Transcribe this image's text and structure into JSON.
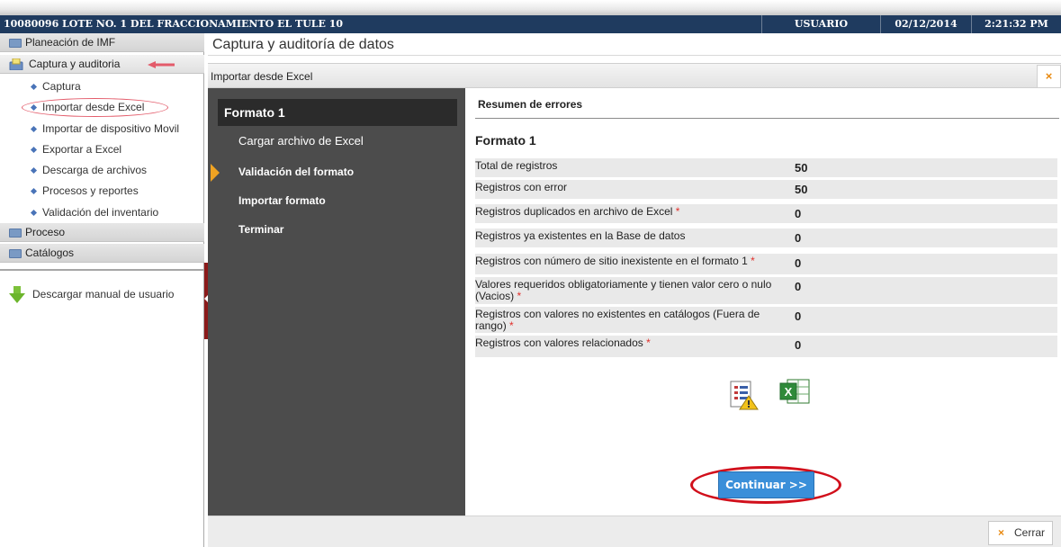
{
  "titlebar": {
    "title": "10080096 LOTE NO. 1 DEL FRACCIONAMIENTO EL TULE 10",
    "user": "USUARIO",
    "date": "02/12/2014",
    "time": "2:21:32 PM"
  },
  "sidebar": {
    "sections": [
      {
        "label": "Planeación de IMF",
        "icon": "folder-icon"
      },
      {
        "label": "Captura y auditoria",
        "icon": "capture-icon",
        "active": true
      },
      {
        "label": "Proceso",
        "icon": "folder-icon"
      },
      {
        "label": "Catálogos",
        "icon": "folder-icon"
      }
    ],
    "items": [
      {
        "label": "Captura"
      },
      {
        "label": "Importar desde Excel",
        "highlighted": true
      },
      {
        "label": "Importar de dispositivo Movil"
      },
      {
        "label": "Exportar a Excel"
      },
      {
        "label": "Descarga de archivos"
      },
      {
        "label": "Procesos y reportes"
      },
      {
        "label": "Validación del inventario"
      }
    ],
    "download_manual": "Descargar manual de usuario"
  },
  "main": {
    "title": "Captura y auditoría de datos",
    "panel_title": "Importar desde Excel",
    "panel_close": "×"
  },
  "wizard": {
    "heading": "Formato 1",
    "steps": [
      {
        "label": "Cargar archivo de Excel"
      },
      {
        "label": "Validación del formato",
        "active": true
      },
      {
        "label": "Importar formato"
      },
      {
        "label": "Terminar"
      }
    ]
  },
  "summary": {
    "title": "Resumen de errores",
    "format_title": "Formato 1",
    "rows": [
      {
        "label": "Total de registros",
        "value": "50",
        "required": false
      },
      {
        "label": "Registros con error",
        "value": "50",
        "required": false
      },
      {
        "label": "Registros duplicados en archivo de Excel",
        "value": "0",
        "required": true
      },
      {
        "label": "Registros ya existentes en la Base de datos",
        "value": "0",
        "required": false
      },
      {
        "label": "Registros con número de sitio inexistente en el formato 1",
        "value": "0",
        "required": true
      },
      {
        "label": "Valores requeridos obligatoriamente y tienen valor cero o nulo (Vacios)",
        "value": "0",
        "required": true
      },
      {
        "label": "Registros con valores no existentes en catálogos (Fuera de rango)",
        "value": "0",
        "required": true
      },
      {
        "label": "Registros con valores relacionados",
        "value": "0",
        "required": true
      }
    ],
    "required_mark": "*",
    "icons": [
      "error-report-icon",
      "excel-icon"
    ],
    "continue_label": "Continuar >>"
  },
  "footer": {
    "close_label": "Cerrar",
    "close_icon": "×"
  },
  "colors": {
    "titlebar": "#1f3b5f",
    "wizard": "#4c4c4c",
    "accent": "#3a8fd9",
    "annotation": "#d10f1b"
  }
}
